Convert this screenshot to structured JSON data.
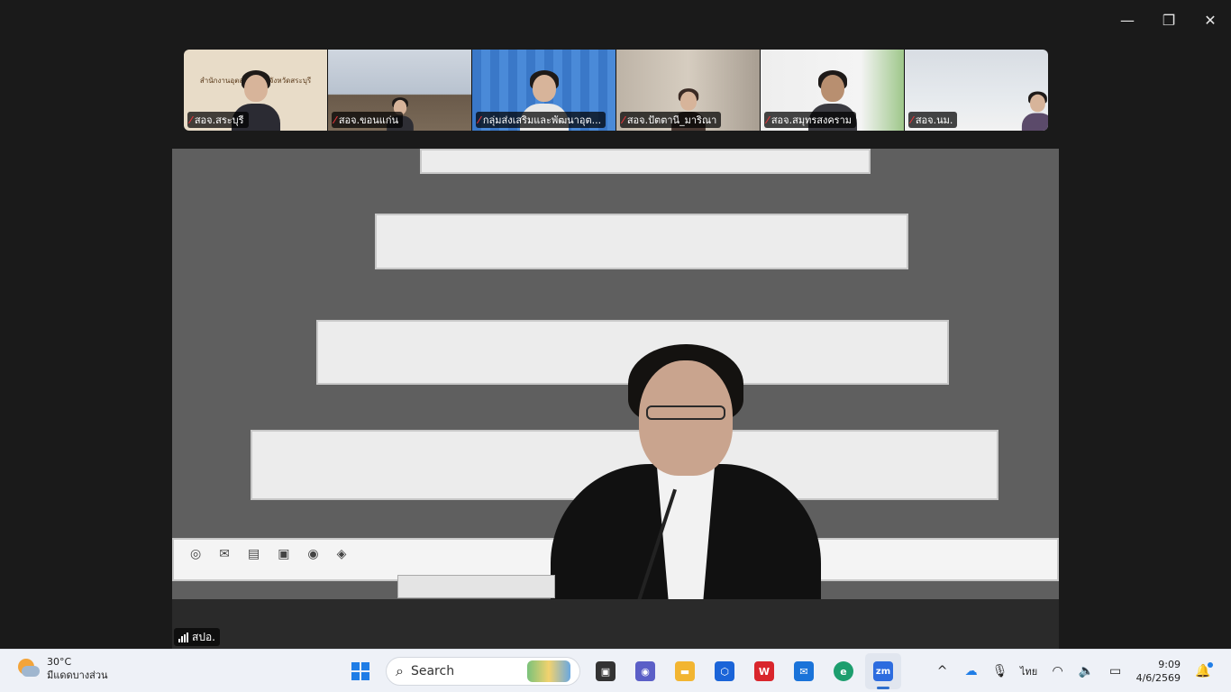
{
  "window": {
    "controls": {
      "minimize": "—",
      "restore": "❐",
      "close": "✕"
    }
  },
  "gallery": {
    "tiles": [
      {
        "name": "สอจ.สระบุรี",
        "muted": true,
        "bg": "#e8dcc8",
        "sign": "สำนักงานอุตสาหกรรมจังหวัดสระบุรี"
      },
      {
        "name": "สอจ.ขอนแก่น",
        "muted": true,
        "bg": "#c9cfd8",
        "sign": ""
      },
      {
        "name": "กลุ่มส่งเสริมและพัฒนาอุต...",
        "muted": true,
        "bg": "#3f7fd0",
        "sign": ""
      },
      {
        "name": "สอจ.ปัตตานี_มาริณา",
        "muted": true,
        "bg": "#bdb3a6",
        "sign": ""
      },
      {
        "name": "สอจ.สมุทรสงคราม",
        "muted": true,
        "bg": "#e9e9e9",
        "sign": ""
      },
      {
        "name": "สอจ.นม.",
        "muted": true,
        "bg": "#d8dde3",
        "sign": ""
      }
    ]
  },
  "speaker": {
    "label": "สปอ."
  },
  "taskbar": {
    "weather": {
      "temp": "30°C",
      "condition": "มีแดดบางส่วน"
    },
    "search": {
      "label": "Search"
    },
    "apps": [
      {
        "id": "task-view",
        "icon": "task-view-icon",
        "glyph": "▣",
        "color": "#333333"
      },
      {
        "id": "meet",
        "icon": "video-chat-icon",
        "glyph": "◉",
        "color": "#5b5fc7"
      },
      {
        "id": "files",
        "icon": "folder-icon",
        "glyph": "▬",
        "color": "#f2b531"
      },
      {
        "id": "copilot",
        "icon": "hexagon-app-icon",
        "glyph": "⬡",
        "color": "#1b64d8"
      },
      {
        "id": "wps",
        "icon": "wps-office-icon",
        "glyph": "W",
        "color": "#d9262c"
      },
      {
        "id": "mail",
        "icon": "mail-icon",
        "glyph": "✉",
        "color": "#1a73d9"
      },
      {
        "id": "edge",
        "icon": "edge-browser-icon",
        "glyph": "e",
        "color": "#1c9e6e"
      },
      {
        "id": "zoom",
        "icon": "zoom-app-icon",
        "glyph": "zm",
        "color": "#2d6cdf",
        "active": true
      }
    ],
    "tray": {
      "chevron": "^",
      "language": "ไทย"
    },
    "clock": {
      "time": "9:09",
      "date": "4/6/2569"
    }
  }
}
